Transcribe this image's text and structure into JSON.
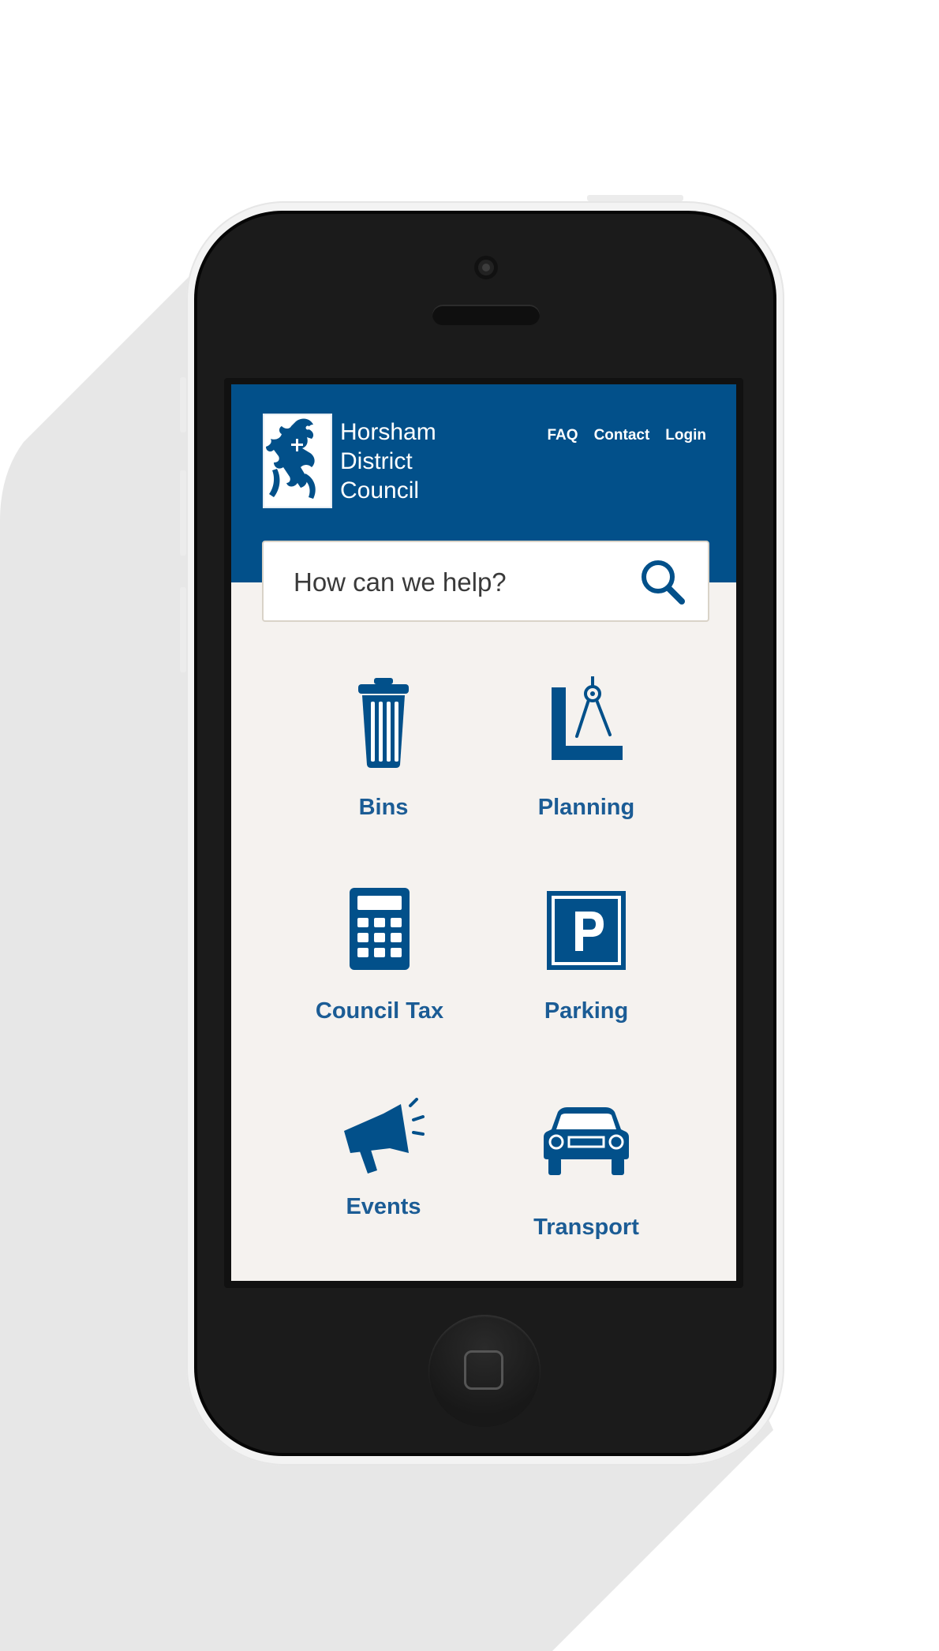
{
  "header": {
    "logo_lines": [
      "Horsham",
      "District",
      "Council"
    ],
    "nav": [
      "FAQ",
      "Contact",
      "Login"
    ]
  },
  "search": {
    "placeholder": "How can we help?"
  },
  "tiles": [
    {
      "label": "Bins",
      "icon": "trash-bin-icon"
    },
    {
      "label": "Planning",
      "icon": "ruler-compass-icon"
    },
    {
      "label": "Council Tax",
      "icon": "calculator-icon"
    },
    {
      "label": "Parking",
      "icon": "parking-sign-icon"
    },
    {
      "label": "Events",
      "icon": "megaphone-icon"
    },
    {
      "label": "Transport",
      "icon": "car-icon"
    }
  ],
  "colors": {
    "brand_blue": "#02508a",
    "link_blue": "#1b5c95",
    "content_bg": "#f5f2ef",
    "device_black": "#1b1b1b"
  }
}
